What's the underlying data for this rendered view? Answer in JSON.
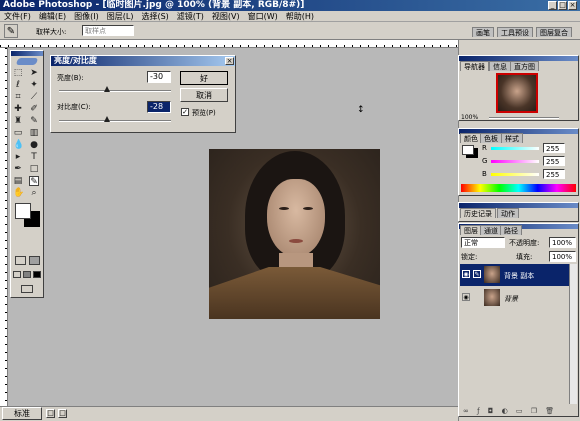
{
  "window": {
    "title": "Adobe Photoshop - [临时图片.jpg @ 100% (背景 副本, RGB/8#)]"
  },
  "menu": [
    "文件(F)",
    "编辑(E)",
    "图像(I)",
    "图层(L)",
    "选择(S)",
    "滤镜(T)",
    "视图(V)",
    "窗口(W)",
    "帮助(H)"
  ],
  "options": {
    "sample_label": "取样大小:",
    "sample_value": "取样点"
  },
  "dock_tabs": [
    "画笔",
    "工具预设",
    "图层复合"
  ],
  "dialog": {
    "title": "亮度/对比度",
    "brightness_label": "亮度(B):",
    "brightness_value": "-30",
    "contrast_label": "对比度(C):",
    "contrast_value": "-28",
    "ok": "好",
    "cancel": "取消",
    "preview_label": "预览(P)",
    "brightness_level": 0.43,
    "contrast_level": 0.43
  },
  "navigator": {
    "tabs": [
      "导航器",
      "信息",
      "直方图"
    ],
    "zoom": "100%"
  },
  "color": {
    "tabs": [
      "颜色",
      "色板",
      "样式"
    ],
    "r_label": "R",
    "r_value": "255",
    "g_label": "G",
    "g_value": "255",
    "b_label": "B",
    "b_value": "255"
  },
  "history": {
    "tabs": [
      "历史记录",
      "动作"
    ]
  },
  "layers": {
    "tabs": [
      "图层",
      "通道",
      "路径"
    ],
    "blend_mode": "正常",
    "opacity_label": "不透明度:",
    "opacity_value": "100%",
    "lock_label": "锁定:",
    "fill_label": "填充:",
    "fill_value": "100%",
    "items": [
      {
        "name": "背景 副本"
      },
      {
        "name": "背景"
      }
    ]
  },
  "status": {
    "mode_label": "标准"
  },
  "colors": {
    "title_blue": "#0a246a",
    "panel": "#d4d0c8",
    "workspace": "#b8b8b8",
    "selected": "#0a246a"
  }
}
